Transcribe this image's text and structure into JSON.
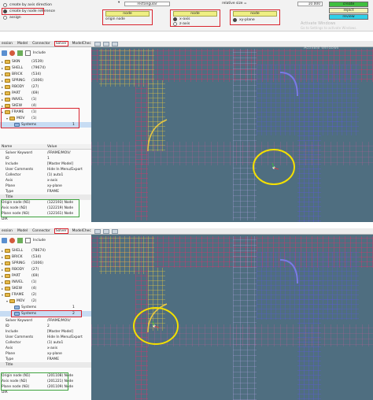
{
  "toolbar": {
    "radio_options": [
      "create by axis direction",
      "create by node reference",
      "assign"
    ],
    "mode_select": "rectangular",
    "relative_size_label": "relative size =",
    "relative_size_value": "10.000",
    "node_slot_1": "node",
    "origin_node_label": "origin node",
    "node_slot_2": "node",
    "x_axis_label": "x-axis",
    "z_axis_label": "z-axis",
    "node_slot_3": "node",
    "xy_plane_label": "xy-plane",
    "create_button": "create",
    "reject_button": "reject",
    "review_button": "review"
  },
  "watermark": {
    "title": "Activate Windows",
    "subtitle": "Go to Settings to activate Windows."
  },
  "pane1": {
    "tabs": [
      "ession",
      "Model",
      "Connector",
      "Solver",
      "ModelChecker"
    ],
    "include_label": "Include",
    "tree": [
      {
        "label": "SKIN",
        "count": "(3539)"
      },
      {
        "label": "SHELL",
        "count": "(79674)"
      },
      {
        "label": "BRICK",
        "count": "(534)"
      },
      {
        "label": "SPRING",
        "count": "(1006)"
      },
      {
        "label": "RBODY",
        "count": "(27)"
      },
      {
        "label": "PART",
        "count": "(69)"
      },
      {
        "label": "INIVEL",
        "count": "(1)"
      },
      {
        "label": "SKEW",
        "count": "(4)"
      },
      {
        "label": "FRAME",
        "count": "(1)"
      },
      {
        "label": "MOV",
        "count": "(1)"
      },
      {
        "label": "Systems",
        "count": "1"
      }
    ],
    "props": {
      "header_name": "Name",
      "header_value": "Value",
      "rows": [
        {
          "k": "Solver Keyword",
          "v": "/FRAME/MOV/"
        },
        {
          "k": "ID",
          "v": "1"
        },
        {
          "k": "Include",
          "v": "[Master Model]"
        },
        {
          "k": "User Comments",
          "v": "Hide In Menu/Export"
        },
        {
          "k": "Collector",
          "v": "(1) auto1"
        },
        {
          "k": "Axis",
          "v": "x-axis"
        },
        {
          "k": "Plane",
          "v": "xy-plane"
        },
        {
          "k": "Type",
          "v": "FRAME"
        },
        {
          "k": "Title",
          "v": ""
        },
        {
          "k": "Origin node (N1)",
          "v": "(122193) Node"
        },
        {
          "k": "Axis node (N2)",
          "v": "(122219) Node"
        },
        {
          "k": "Plane node (N3)",
          "v": "(122161) Node"
        },
        {
          "k": "DIR",
          "v": ""
        }
      ]
    }
  },
  "pane2": {
    "tabs": [
      "ession",
      "Model",
      "Connector",
      "Solver",
      "ModelChecker"
    ],
    "include_label": "Include",
    "tree": [
      {
        "label": "SHELL",
        "count": "(78674)"
      },
      {
        "label": "BRICK",
        "count": "(534)"
      },
      {
        "label": "SPRING",
        "count": "(1006)"
      },
      {
        "label": "RBODY",
        "count": "(27)"
      },
      {
        "label": "PART",
        "count": "(69)"
      },
      {
        "label": "INIVEL",
        "count": "(1)"
      },
      {
        "label": "SKEW",
        "count": "(4)"
      },
      {
        "label": "FRAME",
        "count": "(2)"
      },
      {
        "label": "MOV",
        "count": "(2)"
      },
      {
        "label": "Systems",
        "count": "1"
      },
      {
        "label": "Systems",
        "count": "2"
      }
    ],
    "props": {
      "rows": [
        {
          "k": "Solver Keyword",
          "v": "/FRAME/MOV/"
        },
        {
          "k": "ID",
          "v": "2"
        },
        {
          "k": "Include",
          "v": "[Master Model]"
        },
        {
          "k": "User Comments",
          "v": "Hide In Menu/Export"
        },
        {
          "k": "Collector",
          "v": "(1) auto1"
        },
        {
          "k": "Axis",
          "v": "x-axis"
        },
        {
          "k": "Plane",
          "v": "xy-plane"
        },
        {
          "k": "Type",
          "v": "FRAME"
        },
        {
          "k": "Title",
          "v": ""
        },
        {
          "k": "Origin node (N1)",
          "v": "(201108) Node"
        },
        {
          "k": "Axis node (N2)",
          "v": "(201221) Node"
        },
        {
          "k": "Plane node (N3)",
          "v": "(201109) Node"
        },
        {
          "k": "DIR",
          "v": ""
        }
      ]
    }
  },
  "colors": {
    "highlight_red": "#d9232e",
    "highlight_green": "#3da33d",
    "highlight_yellow": "#f4e000",
    "create_green": "#3fbf3f",
    "review_cyan": "#2fd0e8",
    "mesh_red": "#e0306a",
    "mesh_yellow": "#e8c840",
    "mesh_blue": "#5a5ad8"
  }
}
